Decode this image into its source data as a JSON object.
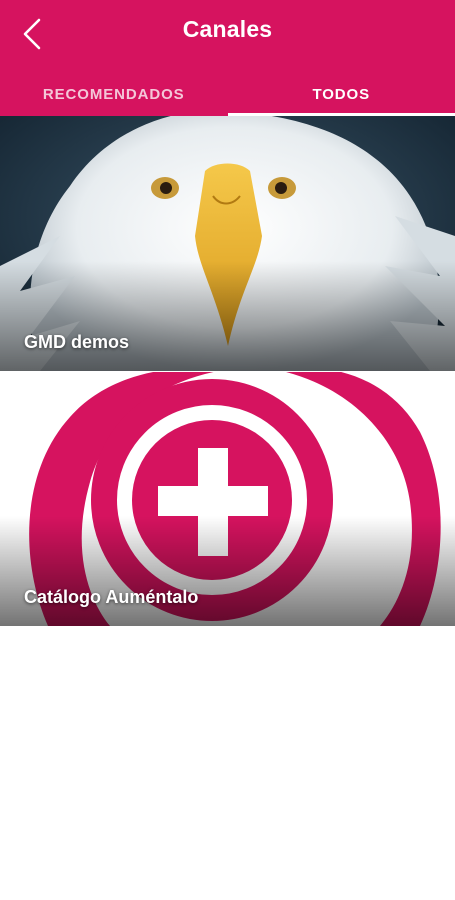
{
  "header": {
    "title": "Canales",
    "back_icon": "chevron-left-icon",
    "background_color": "#d6135f"
  },
  "tabs": [
    {
      "label": "RECOMENDADOS",
      "selected": false
    },
    {
      "label": "TODOS",
      "selected": true
    }
  ],
  "channels": [
    {
      "name": "GMD demos",
      "image": "bald-eagle-photo"
    },
    {
      "name": "Catálogo Auméntalo",
      "image": "pink-plus-logo"
    }
  ],
  "colors": {
    "accent": "#d6135f",
    "tab_inactive_text": "#f4c6d8",
    "tab_active_text": "#ffffff"
  }
}
